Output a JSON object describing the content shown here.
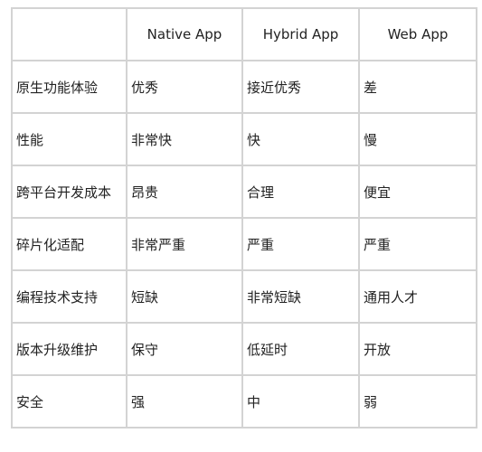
{
  "table": {
    "corner": "",
    "columns": [
      "Native App",
      "Hybrid App",
      "Web App"
    ],
    "rows": [
      {
        "label": "原生功能体验",
        "cells": [
          "优秀",
          "接近优秀",
          "差"
        ]
      },
      {
        "label": "性能",
        "cells": [
          "非常快",
          "快",
          "慢"
        ]
      },
      {
        "label": "跨平台开发成本",
        "cells": [
          "昂贵",
          "合理",
          "便宜"
        ]
      },
      {
        "label": "碎片化适配",
        "cells": [
          "非常严重",
          "严重",
          "严重"
        ]
      },
      {
        "label": "编程技术支持",
        "cells": [
          "短缺",
          "非常短缺",
          "通用人才"
        ]
      },
      {
        "label": "版本升级维护",
        "cells": [
          "保守",
          "低延时",
          "开放"
        ]
      },
      {
        "label": "安全",
        "cells": [
          "强",
          "中",
          "弱"
        ]
      }
    ]
  },
  "colors": {
    "border": "#d3d3d3",
    "text": "#222222",
    "background": "#ffffff"
  }
}
